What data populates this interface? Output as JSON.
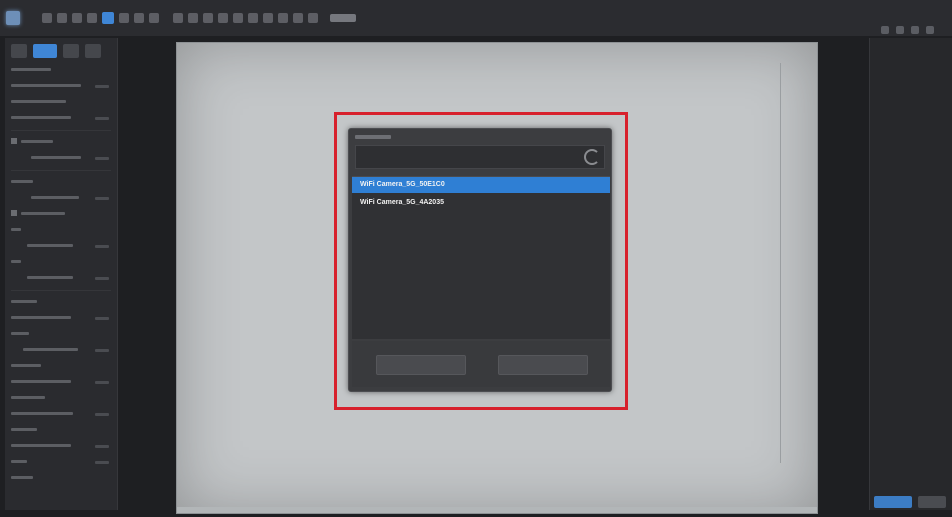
{
  "dialog": {
    "devices": [
      {
        "name": "WiFi Camera_5G_50E1C0",
        "selected": true
      },
      {
        "name": "WiFi Camera_5G_4A2035",
        "selected": false
      }
    ]
  },
  "colors": {
    "accent": "#2f7fd4",
    "highlight_frame": "#d7202c",
    "background": "#1e1f22"
  },
  "icons": {
    "app": "app-logo-icon",
    "refresh": "refresh-icon"
  }
}
